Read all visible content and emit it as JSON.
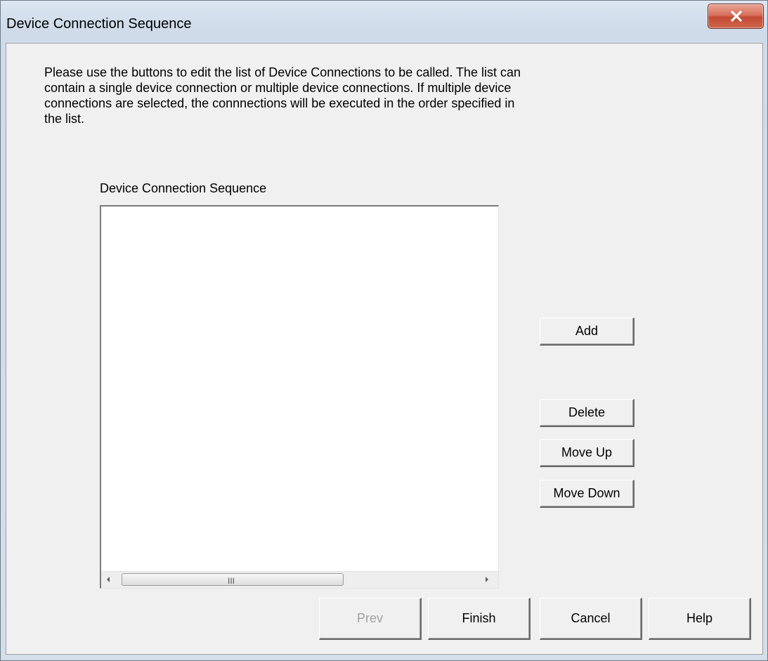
{
  "window": {
    "title": "Device Connection Sequence",
    "close_icon": "close-icon"
  },
  "dialog": {
    "instructions": "Please use the buttons to edit the list of Device Connections to be called.  The list can contain a single device connection or multiple device connections.  If multiple device connections are selected, the connnections will be executed in the order specified in the list.",
    "list_label": "Device Connection Sequence",
    "list_items": [],
    "scrollbar_grip": "III"
  },
  "side_buttons": {
    "add": "Add",
    "delete": "Delete",
    "move_up": "Move Up",
    "move_down": "Move Down"
  },
  "footer_buttons": {
    "prev": "Prev",
    "finish": "Finish",
    "cancel": "Cancel",
    "help": "Help"
  },
  "colors": {
    "dialog_background": "#f0f0f0",
    "close_button": "#c7503a",
    "disabled_text": "#a0a0a0"
  }
}
